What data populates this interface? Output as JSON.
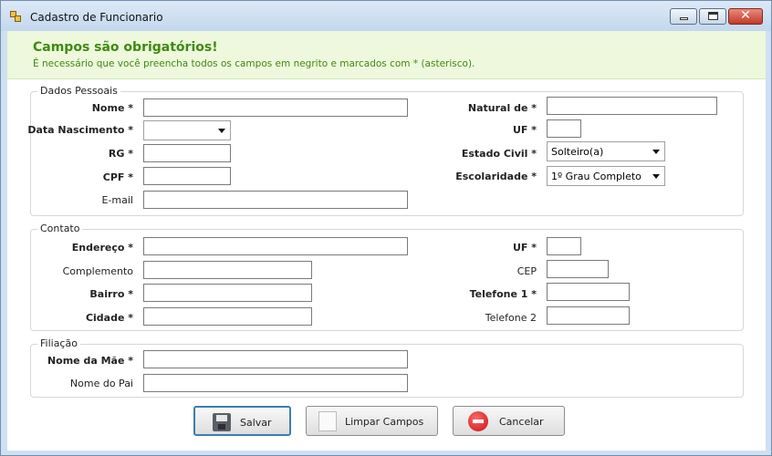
{
  "window": {
    "title": "Cadastro de Funcionario"
  },
  "notice": {
    "title": "Campos são obrigatórios!",
    "text": "É necessário que você preencha todos os campos em negrito e marcados com * (asterisco)."
  },
  "dados_pessoais": {
    "legend": "Dados Pessoais",
    "nome_label": "Nome *",
    "nome_value": "",
    "data_nascimento_label": "Data Nascimento *",
    "data_nascimento_value": "",
    "rg_label": "RG *",
    "rg_value": "",
    "cpf_label": "CPF *",
    "cpf_value": "",
    "email_label": "E-mail",
    "email_value": "",
    "natural_label": "Natural de *",
    "natural_value": "",
    "uf_label": "UF *",
    "uf_value": "",
    "estado_civil_label": "Estado Civil *",
    "estado_civil_value": "Solteiro(a)",
    "escolaridade_label": "Escolaridade *",
    "escolaridade_value": "1º Grau Completo"
  },
  "contato": {
    "legend": "Contato",
    "endereco_label": "Endereço *",
    "endereco_value": "",
    "complemento_label": "Complemento",
    "complemento_value": "",
    "bairro_label": "Bairro *",
    "bairro_value": "",
    "cidade_label": "Cidade *",
    "cidade_value": "",
    "uf_label": "UF *",
    "uf_value": "",
    "cep_label": "CEP",
    "cep_value": "",
    "telefone1_label": "Telefone 1 *",
    "telefone1_value": "",
    "telefone2_label": "Telefone 2",
    "telefone2_value": ""
  },
  "filiacao": {
    "legend": "Filiação",
    "mae_label": "Nome da Mãe *",
    "mae_value": "",
    "pai_label": "Nome do Pai",
    "pai_value": ""
  },
  "buttons": {
    "save_label": "Salvar",
    "clear_label": "Limpar Campos",
    "cancel_label": "Cancelar"
  },
  "icons": {
    "app": "app-icon",
    "save": "floppy-disk-icon",
    "clear": "blank-document-icon",
    "cancel": "red-minus-circle-icon"
  },
  "colors": {
    "notice_bg": "#eef8dc",
    "notice_text": "#3e8a12",
    "focus_border": "#3c7fb1"
  }
}
